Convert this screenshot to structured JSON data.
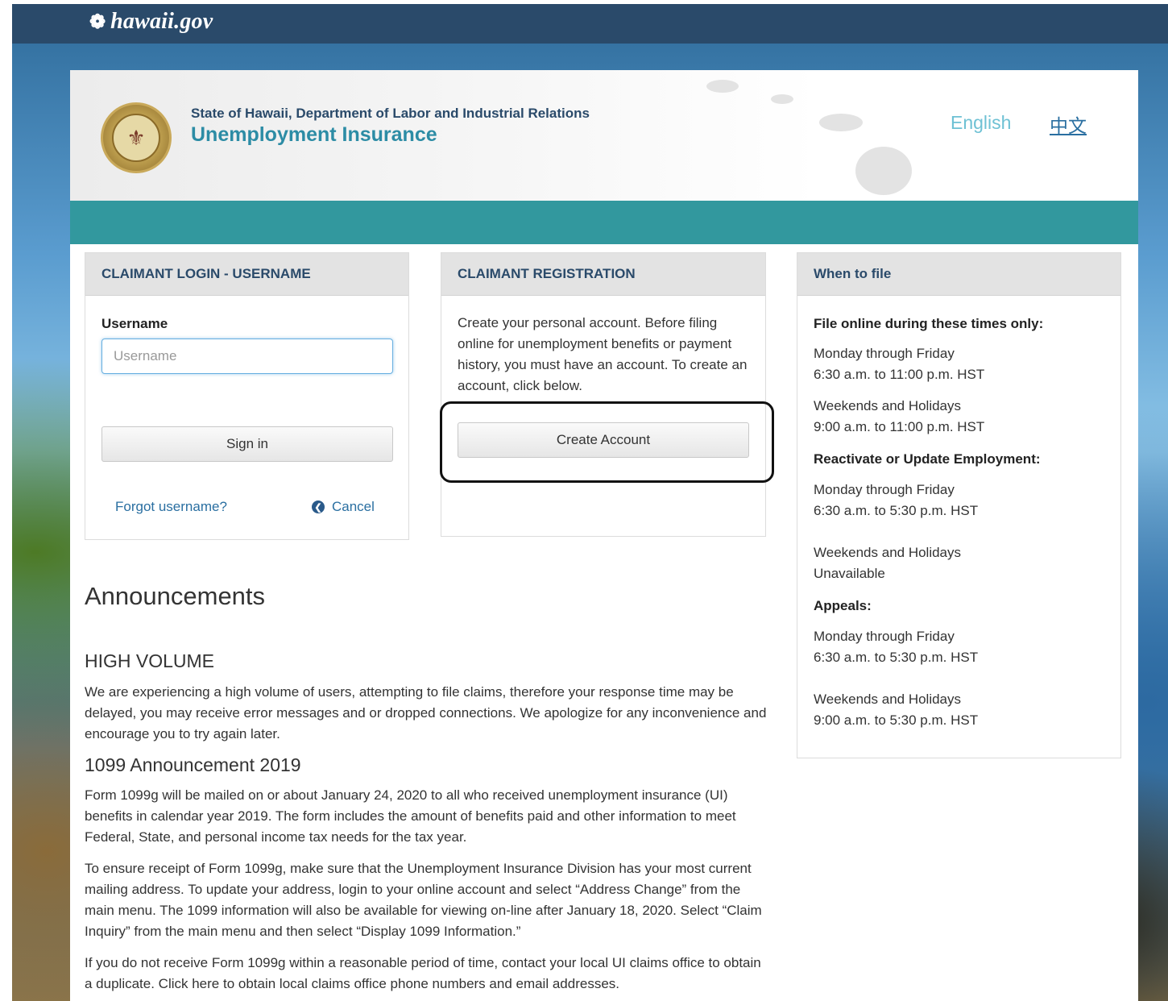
{
  "site": {
    "logo_text": "hawaii.gov",
    "logo_icon": "hibiscus-icon"
  },
  "header": {
    "agency": "State of Hawaii, Department of Labor and Industrial Relations",
    "program": "Unemployment Insurance",
    "languages": [
      "English",
      "中文"
    ]
  },
  "login": {
    "title": "CLAIMANT LOGIN - USERNAME",
    "username_label": "Username",
    "username_placeholder": "Username",
    "username_value": "",
    "signin_label": "Sign in",
    "forgot_label": "Forgot username?",
    "cancel_label": "Cancel"
  },
  "registration": {
    "title": "CLAIMANT REGISTRATION",
    "description": "Create your personal account. Before filing online for unemployment benefits or payment history, you must have an account. To create an account, click below.",
    "create_label": "Create Account"
  },
  "schedule": {
    "title": "When to file",
    "sections": [
      {
        "heading": "File online during these times only:",
        "blocks": [
          [
            "Monday through Friday",
            "6:30 a.m. to 11:00 p.m. HST"
          ],
          [
            "Weekends and Holidays",
            "9:00 a.m. to 11:00 p.m. HST"
          ]
        ]
      },
      {
        "heading": "Reactivate or Update Employment:",
        "blocks": [
          [
            "Monday through Friday",
            "6:30 a.m. to 5:30 p.m. HST"
          ],
          [
            "Weekends and Holidays",
            "Unavailable"
          ]
        ]
      },
      {
        "heading": "Appeals:",
        "blocks": [
          [
            "Monday through Friday",
            "6:30 a.m. to 5:30 p.m. HST"
          ],
          [
            "Weekends and Holidays",
            "9:00 a.m. to 5:30 p.m. HST"
          ]
        ]
      }
    ]
  },
  "announcements": {
    "title": "Announcements",
    "items": [
      {
        "heading": "HIGH VOLUME",
        "paragraphs": [
          "We are experiencing a high volume of users, attempting to file claims, therefore your response time may be delayed, you may receive error messages and or dropped connections. We apologize for any inconvenience and encourage you to try again later."
        ]
      },
      {
        "heading": "1099 Announcement 2019",
        "paragraphs": [
          "Form 1099g will be mailed on or about January 24, 2020 to all who received unemployment insurance (UI) benefits in calendar year 2019. The form includes the amount of benefits paid and other information to meet Federal, State, and personal income tax needs for the tax year.",
          "To ensure receipt of Form 1099g, make sure that the Unemployment Insurance Division has your most current mailing address. To update your address, login to your online account and select “Address Change” from the main menu. The 1099 information will also be available for viewing on-line after January 18, 2020. Select “Claim Inquiry” from the main menu and then select “Display 1099 Information.”",
          "If you do not receive Form 1099g within a reasonable period of time, contact your local UI claims office to obtain a duplicate. Click here to obtain local claims office phone numbers and email addresses."
        ]
      }
    ]
  }
}
